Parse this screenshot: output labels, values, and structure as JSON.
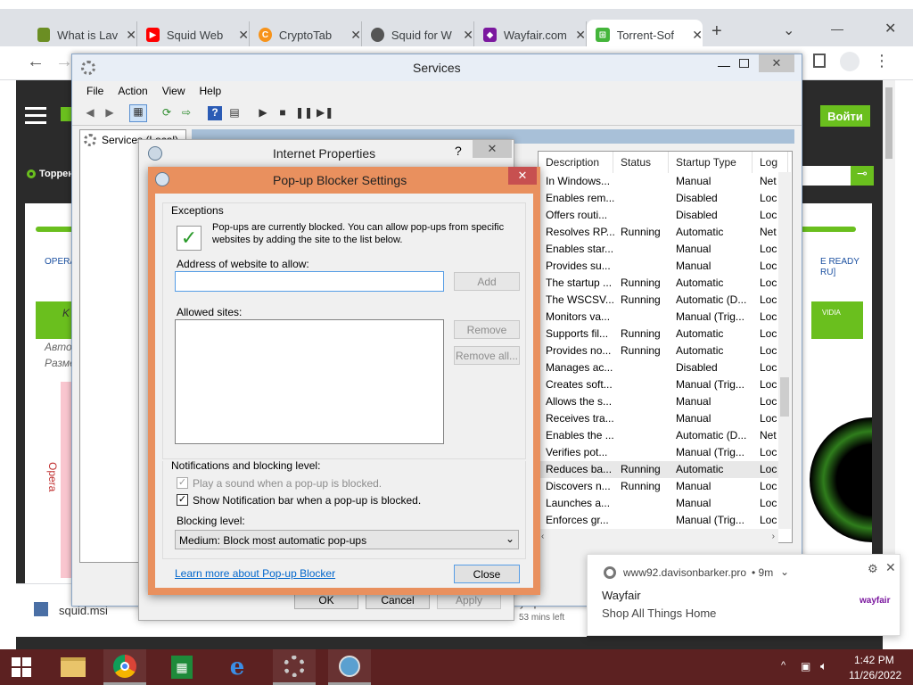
{
  "browser": {
    "tabs": [
      {
        "title": "What is Lav",
        "color": "#6b8e23"
      },
      {
        "title": "Squid Web",
        "color": "#ff0000"
      },
      {
        "title": "CryptoTab",
        "color": "#f7931a"
      },
      {
        "title": "Squid for W",
        "color": "#555555"
      },
      {
        "title": "Wayfair.com",
        "color": "#7b189f"
      },
      {
        "title": "Torrent-Sof",
        "color": "#44b53b"
      }
    ],
    "new_tab": "+",
    "chevron": "⌄"
  },
  "site": {
    "login_button": "Войти",
    "torrent_label": "Торрен",
    "opera_link": "OPERA",
    "ready_text": "E READY",
    "ru_text": "RU]",
    "nvidia_text": "VIDIA",
    "author": "Автор",
    "size": "Разме",
    "opera_vertical": "Opera",
    "download_file": "squid.msi",
    "download_file2": "ty.zip",
    "download_time": "53 mins left",
    "kb": "K"
  },
  "services": {
    "title": "Services",
    "menu": [
      "File",
      "Action",
      "View",
      "Help"
    ],
    "tree_root": "Services (Local)",
    "breadcrumb": "Services (Local)",
    "columns": [
      "Description",
      "Status",
      "Startup Type",
      "Log"
    ],
    "rows": [
      [
        "In Windows...",
        "",
        "Manual",
        "Net"
      ],
      [
        "Enables rem...",
        "",
        "Disabled",
        "Loc"
      ],
      [
        "Offers routi...",
        "",
        "Disabled",
        "Loc"
      ],
      [
        "Resolves RP...",
        "Running",
        "Automatic",
        "Net"
      ],
      [
        "Enables star...",
        "",
        "Manual",
        "Loc"
      ],
      [
        "Provides su...",
        "",
        "Manual",
        "Loc"
      ],
      [
        "The startup ...",
        "Running",
        "Automatic",
        "Loc"
      ],
      [
        "The WSCSV...",
        "Running",
        "Automatic (D...",
        "Loc"
      ],
      [
        "Monitors va...",
        "",
        "Manual (Trig...",
        "Loc"
      ],
      [
        "Supports fil...",
        "Running",
        "Automatic",
        "Loc"
      ],
      [
        "Provides no...",
        "Running",
        "Automatic",
        "Loc"
      ],
      [
        "Manages ac...",
        "",
        "Disabled",
        "Loc"
      ],
      [
        "Creates soft...",
        "",
        "Manual (Trig...",
        "Loc"
      ],
      [
        "Allows the s...",
        "",
        "Manual",
        "Loc"
      ],
      [
        "Receives tra...",
        "",
        "Manual",
        "Loc"
      ],
      [
        "Enables the ...",
        "",
        "Automatic (D...",
        "Net"
      ],
      [
        "Verifies pot...",
        "",
        "Manual (Trig...",
        "Loc"
      ],
      [
        "Reduces ba...",
        "Running",
        "Automatic",
        "Loc"
      ],
      [
        "Discovers n...",
        "Running",
        "Manual",
        "Loc"
      ],
      [
        "Launches a...",
        "",
        "Manual",
        "Loc"
      ],
      [
        "Enforces gr...",
        "",
        "Manual (Trig...",
        "Loc"
      ]
    ],
    "selected_row": 17
  },
  "internet_properties": {
    "title": "Internet Properties",
    "help": "?",
    "ok": "OK",
    "cancel": "Cancel",
    "apply": "Apply"
  },
  "popup_blocker": {
    "title": "Pop-up Blocker Settings",
    "exceptions_label": "Exceptions",
    "info_line1": "Pop-ups are currently blocked.  You can allow pop-ups from specific",
    "info_line2": "websites by adding the site to the list below.",
    "address_label": "Address of website to allow:",
    "address_value": "",
    "add_button": "Add",
    "allowed_label": "Allowed sites:",
    "remove_button": "Remove",
    "remove_all_button": "Remove all...",
    "notif_group_label": "Notifications and blocking level:",
    "play_sound_label": "Play a sound when a pop-up is blocked.",
    "show_bar_label": "Show Notification bar when a pop-up is blocked.",
    "blocking_level_label": "Blocking level:",
    "blocking_level_value": "Medium: Block most automatic pop-ups",
    "learn_more": "Learn more about Pop-up Blocker",
    "close_button": "Close"
  },
  "notification": {
    "source": "www92.davisonbarker.pro",
    "time": "• 9m",
    "title": "Wayfair",
    "body": "Shop All Things Home",
    "brand": "wayfair"
  },
  "taskbar": {
    "time": "1:42 PM",
    "date": "11/26/2022"
  },
  "colors": {
    "taskbar": "#5c2121",
    "popup_frame": "#e9905e",
    "site_green": "#6abf1e"
  }
}
